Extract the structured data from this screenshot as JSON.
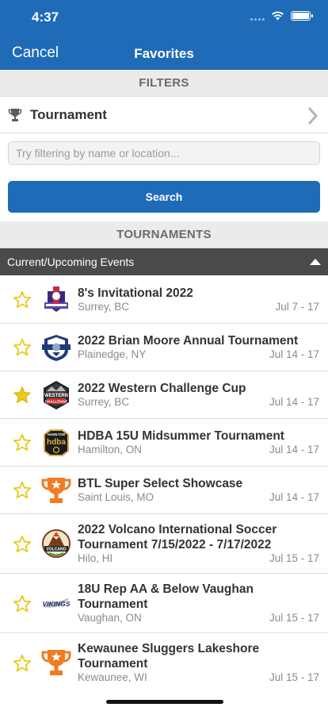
{
  "status_bar": {
    "time": "4:37"
  },
  "nav": {
    "cancel_label": "Cancel",
    "title": "Favorites"
  },
  "filters": {
    "header": "FILTERS",
    "tournament_label": "Tournament",
    "search_placeholder": "Try filtering by name or location...",
    "search_value": "",
    "search_button": "Search"
  },
  "tournaments": {
    "header": "TOURNAMENTS",
    "group_label": "Current/Upcoming Events",
    "events": [
      {
        "name": "8's Invitational 2022",
        "location": "Surrey, BC",
        "dates": "Jul 7 - 17",
        "favorited": false,
        "logo": "invitational-logo"
      },
      {
        "name": "2022 Brian Moore Annual Tournament",
        "location": "Plainedge, NY",
        "dates": "Jul 14 - 17",
        "favorited": false,
        "logo": "shield-crest-logo"
      },
      {
        "name": "2022 Western Challenge Cup",
        "location": "Surrey, BC",
        "dates": "Jul 14 - 17",
        "favorited": true,
        "logo": "western-challenge-logo"
      },
      {
        "name": "HDBA 15U Midsummer Tournament",
        "location": "Hamilton, ON",
        "dates": "Jul 14 - 17",
        "favorited": false,
        "logo": "hamilton-hdba-logo"
      },
      {
        "name": "BTL Super Select Showcase",
        "location": "Saint Louis, MO",
        "dates": "Jul 14 - 17",
        "favorited": false,
        "logo": "trophy-logo"
      },
      {
        "name": "2022 Volcano International Soccer Tournament 7/15/2022 - 7/17/2022",
        "location": "Hilo, HI",
        "dates": "Jul 15 - 17",
        "favorited": false,
        "logo": "volcano-logo"
      },
      {
        "name": "18U Rep AA & Below Vaughan Tournament",
        "location": "Vaughan, ON",
        "dates": "Jul 15 - 17",
        "favorited": false,
        "logo": "vikings-logo"
      },
      {
        "name": "Kewaunee Sluggers Lakeshore Tournament",
        "location": "Kewaunee, WI",
        "dates": "Jul 15 - 17",
        "favorited": false,
        "logo": "trophy-logo"
      }
    ]
  },
  "logo_text": {
    "western": [
      "WESTERN",
      "CHALLENGE"
    ],
    "hamilton_top": "HAMILTON",
    "hamilton_mid": "hdba",
    "volcano": "VOLCANO",
    "vikings": "VIKINGS"
  },
  "colors": {
    "brand_blue": "#1f6bb8",
    "star_gold": "#e8c919",
    "group_bar": "#4a4a48",
    "trophy_orange": "#f07b22"
  }
}
